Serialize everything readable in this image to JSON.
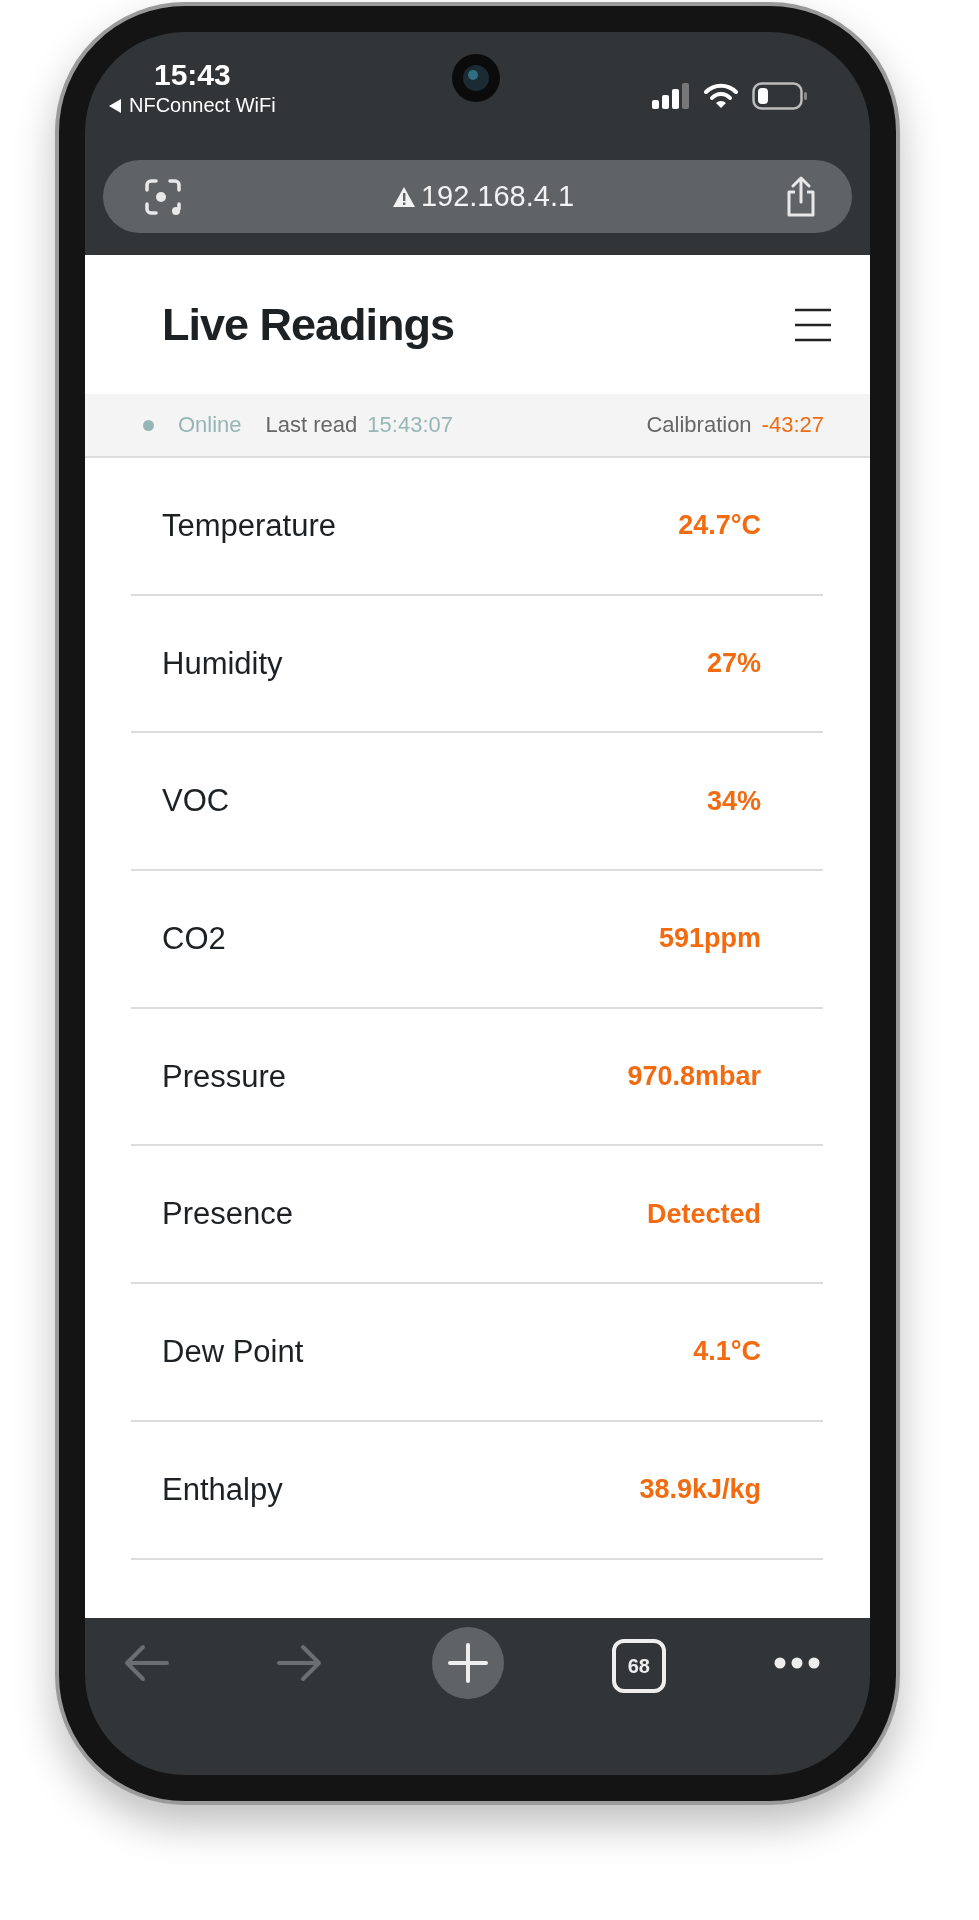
{
  "status_bar": {
    "time": "15:43",
    "back_app": "NFConnect WiFi"
  },
  "address_bar": {
    "url": "192.168.4.1",
    "insecure": true
  },
  "header": {
    "title": "Live Readings"
  },
  "status_strip": {
    "connection": "Online",
    "online": true,
    "last_read_label": "Last read",
    "last_read": "15:43:07",
    "calibration_label": "Calibration",
    "calibration": "-43:27"
  },
  "readings": [
    {
      "label": "Temperature",
      "value": "24.7°C"
    },
    {
      "label": "Humidity",
      "value": "27%"
    },
    {
      "label": "VOC",
      "value": "34%"
    },
    {
      "label": "CO2",
      "value": "591ppm"
    },
    {
      "label": "Pressure",
      "value": "970.8mbar"
    },
    {
      "label": "Presence",
      "value": "Detected"
    },
    {
      "label": "Dew Point",
      "value": "4.1°C"
    },
    {
      "label": "Enthalpy",
      "value": "38.9kJ/kg"
    }
  ],
  "toolbar": {
    "back_disabled": true,
    "forward_disabled": true,
    "tab_count": "68"
  }
}
